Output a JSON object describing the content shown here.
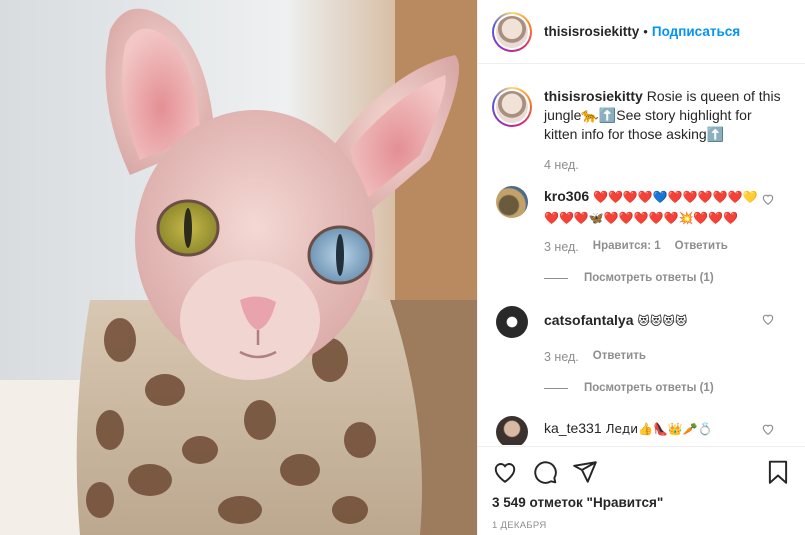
{
  "post": {
    "username": "thisisrosiekitty",
    "separator": "•",
    "follow_label": "Подписаться",
    "caption_text": "Rosie is queen of this jungle🐆⬆️See story highlight for kitten info for those asking⬆️",
    "caption_time": "4 нед."
  },
  "comments": [
    {
      "username": "kro306",
      "text": "❤️❤️❤️❤️💙❤️❤️❤️❤️❤️💛❤️❤️❤️🦋❤️❤️❤️❤️❤️💥❤️❤️❤️",
      "time": "3 нед.",
      "likes": "Нравится: 1",
      "reply": "Ответить",
      "view_replies": "Посмотреть ответы (1)"
    },
    {
      "username": "catsofantalya",
      "text": "😻😻😻😻",
      "time": "3 нед.",
      "reply": "Ответить",
      "view_replies": "Посмотреть ответы (1)"
    },
    {
      "username": "ka_te331",
      "text": "Леди👍👠👑🥕💍"
    }
  ],
  "likes_count": "3 549 отметок \"Нравится\"",
  "date": "1 ДЕКАБРЯ",
  "icons": {
    "like": "heart-icon",
    "comment": "comment-icon",
    "share": "share-icon",
    "save": "bookmark-icon"
  }
}
